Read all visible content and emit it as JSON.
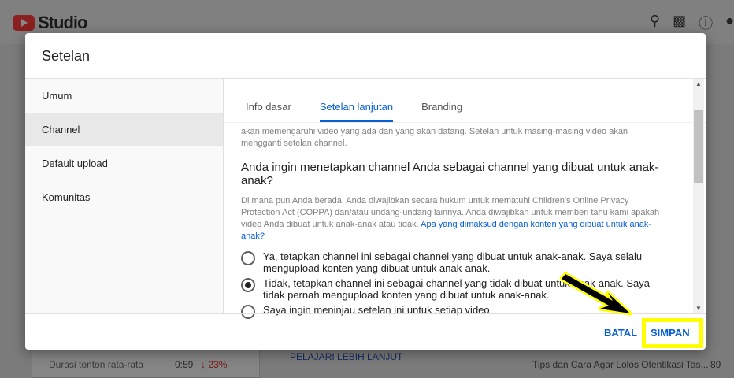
{
  "app": {
    "logo_text": "Studio"
  },
  "background": {
    "stat_label": "Durasi tonton rata-rata",
    "stat_value": "0:59",
    "stat_change": "23%",
    "learn_more": "PELAJARI LEBIH LANJUT",
    "video_title": "Tips dan Cara Agar Lolos Otentikasi Tas...",
    "video_count": "89"
  },
  "dialog": {
    "title": "Setelan",
    "sidebar": [
      {
        "label": "Umum"
      },
      {
        "label": "Channel"
      },
      {
        "label": "Default upload"
      },
      {
        "label": "Komunitas"
      }
    ],
    "tabs": [
      {
        "label": "Info dasar"
      },
      {
        "label": "Setelan lanjutan"
      },
      {
        "label": "Branding"
      }
    ],
    "intro": "akan memengaruhi video yang ada dan yang akan datang. Setelan untuk masing-masing video akan mengganti setelan channel.",
    "question": "Anda ingin menetapkan channel Anda sebagai channel yang dibuat untuk anak-anak?",
    "description": "Di mana pun Anda berada, Anda diwajibkan secara hukum untuk mematuhi Children's Online Privacy Protection Act (COPPA) dan/atau undang-undang lainnya. Anda diwajibkan untuk memberi tahu kami apakah video Anda dibuat untuk anak-anak atau tidak.",
    "link": "Apa yang dimaksud dengan konten yang dibuat untuk anak-anak?",
    "options": [
      {
        "label": "Ya, tetapkan channel ini sebagai channel yang dibuat untuk anak-anak. Saya selalu mengupload konten yang dibuat untuk anak-anak.",
        "selected": false
      },
      {
        "label": "Tidak, tetapkan channel ini sebagai channel yang tidak dibuat untuk anak-anak. Saya tidak pernah mengupload konten yang dibuat untuk anak-anak.",
        "selected": true
      },
      {
        "label": "Saya ingin meninjau setelan ini untuk setiap video.",
        "selected": false
      }
    ],
    "cancel": "BATAL",
    "save": "SIMPAN"
  },
  "annotation": {
    "color": "#ffff00"
  }
}
